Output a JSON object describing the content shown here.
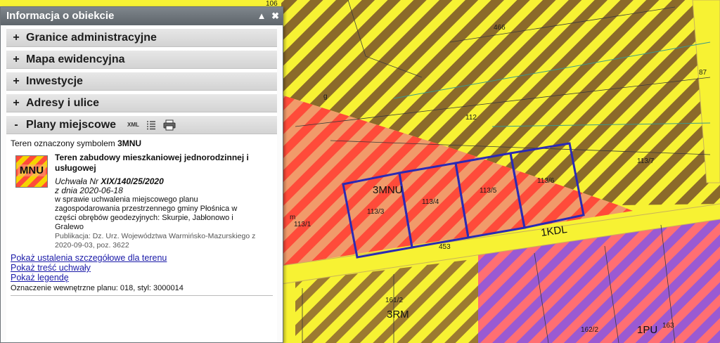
{
  "panel": {
    "title": "Informacja o obiekcie",
    "collapse_icon": "triangle-up-icon",
    "close_icon": "close-icon",
    "sections": [
      {
        "sign": "+",
        "label": "Granice administracyjne"
      },
      {
        "sign": "+",
        "label": "Mapa ewidencyjna"
      },
      {
        "sign": "+",
        "label": "Inwestycje"
      },
      {
        "sign": "+",
        "label": "Adresy i ulice"
      },
      {
        "sign": "-",
        "label": "Plany miejscowe"
      }
    ],
    "tools": {
      "xml_label": "XML",
      "list_icon": "list-icon",
      "print_icon": "printer-icon"
    },
    "content": {
      "intro_prefix": "Teren oznaczony symbolem",
      "intro_symbol": "3MNU",
      "icon_label": "MNU",
      "title": "Teren zabudowy mieszkaniowej jednorodzinnej i usługowej",
      "resolution_prefix": "Uchwała Nr",
      "resolution_number": "XIX/140/25/2020",
      "date_line": "z dnia 2020-06-18",
      "description": "w sprawie uchwalenia miejscowego planu zagospodarowania przestrzennego gminy Płośnica w części obrębów geodezyjnych: Skurpie, Jabłonowo i Gralewo",
      "publication": "Publikacja: Dz. Urz. Województwa Warmińsko-Mazurskiego z 2020-09-03, poz. 3622",
      "links": [
        "Pokaż ustalenia szczegółowe dla terenu",
        "Pokaż treść uchwały",
        "Pokaż legendę"
      ],
      "internal": "Oznaczenie wewnętrzne planu: 018, styl: 3000014"
    }
  },
  "map": {
    "parcels": [
      "106",
      "466",
      "87",
      "112",
      "113/7",
      "113/1",
      "113/3",
      "113/4",
      "113/5",
      "113/6",
      "453",
      "161/2",
      "162/2",
      "163"
    ],
    "zones": [
      "3MNU",
      "1KDL",
      "3RM",
      "1PU",
      "g",
      "m"
    ],
    "colors": {
      "residential": "#ff4b3a",
      "road": "#f7f233",
      "agri": "#8b6a2a",
      "industry": "#9a5ad2",
      "selection": "#2a2ab4"
    }
  }
}
